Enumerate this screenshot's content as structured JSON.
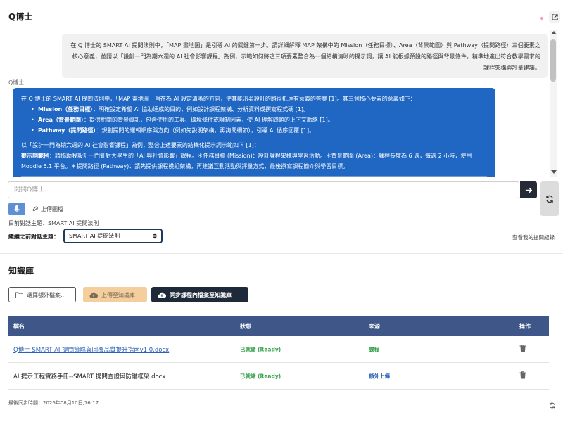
{
  "header": {
    "title": "Q博士"
  },
  "chat": {
    "user_message": "在 Q 博士的 SMART AI 提問法則中，「MAP 畫地圖」是引導 AI 的關鍵第一步。請詳細解釋 MAP 架構中的 Mission（任務目標）、Area（背景範圍）與 Pathway（提問路徑）三個要素之核心意義，並請以「設計一門為期六週的 AI 社會影響課程」為例，示範如何將這三項要素整合為一個結構清晰的提示詞，讓 AI 能根據預設的路徑與背景條件，精準地產出符合教學需求的課程架構與評量建議。",
    "bot_name": "Q博士",
    "bot_intro": "在 Q 博士的 SMART AI 提問法則中，「MAP 畫地圖」旨在為 AI 設定清晰的方向，使其能沿著設計的路徑抵達有意義的答案 [1]。其三個核心要素的意義如下：",
    "bot_items": [
      {
        "term": "Mission（任務目標）",
        "desc": "：明確設定希望 AI 協助達成的目的，例如設計課程架構、分析資料或撰寫程式碼 [1]。"
      },
      {
        "term": "Area（背景範圍）",
        "desc": "：提供相關的背景資訊，包含使用的工具、環境條件或限制因素，使 AI 理解問題的上下文脈絡 [1]。"
      },
      {
        "term": "Pathway（提問路徑）",
        "desc": "：規劃提問的邏輯順序與方向（例如先說明架構，再詢問細節），引導 AI 循序回覆 [1]。"
      }
    ],
    "bot_example_intro": "以「設計一門為期六週的 AI 社會影響課程」為例，整合上述要素的結構化提示詞示範如下 [1]：",
    "bot_example_label": "提示詞範例",
    "bot_example_text": "：請協助我設計一門針對大學生的「AI 與社會影響」課程。＊任務目標 (Mission)：設計課程架構與學習活動。＊背景範圍 (Area)：課程長度為 6 週，每週 2 小時，使用 Moodle 5.1 平台。＊提問路徑 (Pathway)：請先提供課程模組架構，再建議互動活動與評量方式，最後撰寫課程簡介與學習目標。"
  },
  "input": {
    "placeholder": "問問Q博士..."
  },
  "tools": {
    "upload_label": "上傳圖檔"
  },
  "topic": {
    "current_label": "目前對話主題：",
    "current_value": "SMART AI 提問法則",
    "continue_label": "繼續之前對話主題：",
    "selected": "SMART AI 提問法則",
    "history_link": "查看我的提問紀錄"
  },
  "kb": {
    "title": "知識庫",
    "choose_btn": "選擇額外檔案...",
    "upload_btn": "上傳至知識庫",
    "sync_btn": "同步課程內檔案至知識庫",
    "columns": [
      "檔名",
      "狀態",
      "來源",
      "操作"
    ],
    "rows": [
      {
        "name": "Q博士 SMART AI 提問策略與回覆品質提升指南v1.0.docx",
        "status": "已就緒 (Ready)",
        "source": "課程"
      },
      {
        "name": "AI 提示工程實務手冊--SMART 提問查證與防錯框架.docx",
        "status": "已就緒 (Ready)",
        "source": "額外上傳"
      }
    ],
    "last_sync": "最後同步時間：2026年08月10日,16:17"
  }
}
